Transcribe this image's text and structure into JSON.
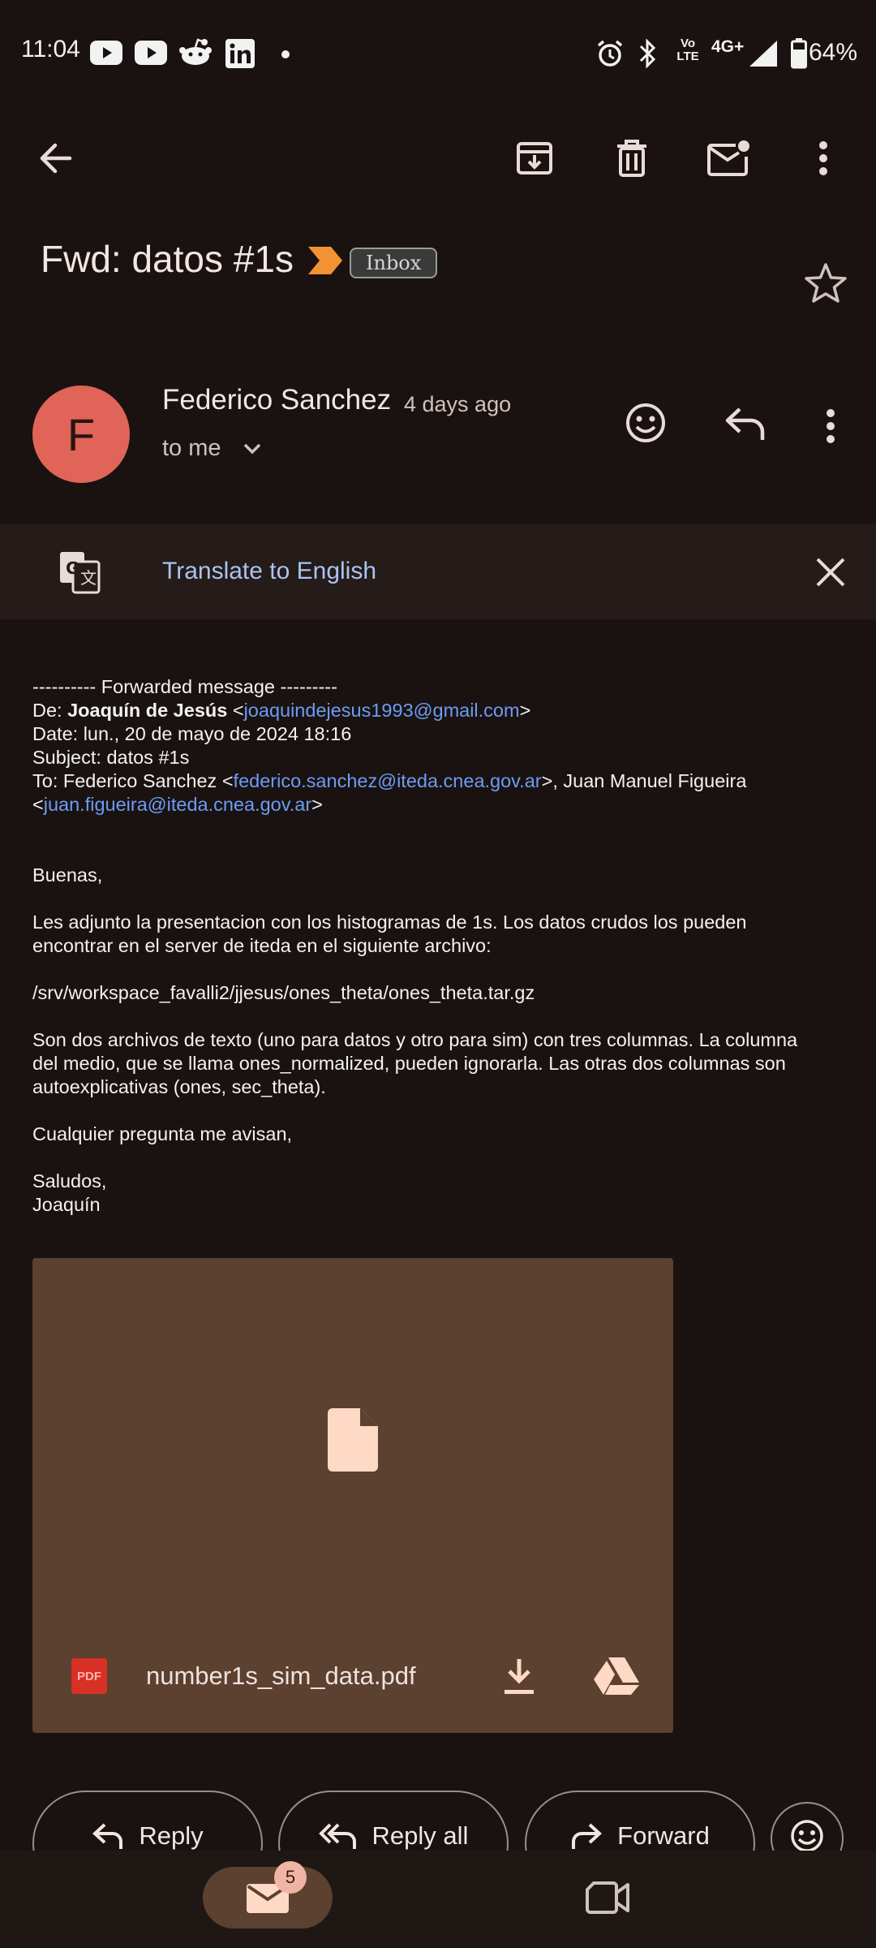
{
  "status_bar": {
    "time": "11:04",
    "battery": "64%",
    "network": "4G+",
    "network_sub": "Vo LTE",
    "icons": [
      "youtube-icon",
      "youtube-icon",
      "reddit-icon",
      "linkedin-icon",
      "dot-icon",
      "alarm-icon",
      "bluetooth-icon",
      "volte-icon",
      "signal-icon",
      "battery-icon"
    ]
  },
  "toolbar": {
    "icons": [
      "back-arrow-icon",
      "archive-icon",
      "delete-icon",
      "mark-unread-icon",
      "more-vert-icon"
    ]
  },
  "email": {
    "subject": "Fwd: datos #1s",
    "label": "Inbox",
    "sender_initial": "F",
    "sender_name": "Federico Sanchez",
    "time": "4 days ago",
    "recipient": "to me"
  },
  "translate": {
    "label": "Translate to English"
  },
  "body": {
    "fwd_header": "---------- Forwarded message ---------",
    "from_prefix": "De: ",
    "from_name": "Joaquín de Jesús",
    "from_open": " <",
    "from_email": "joaquindejesus1993@gmail.com",
    "from_close": ">",
    "date": "Date: lun., 20 de mayo de 2024 18:16",
    "subject": "Subject: datos #1s",
    "to_prefix": "To: Federico Sanchez <",
    "to_email1": "federico.sanchez@iteda.cnea.gov.ar",
    "to_mid": ">, Juan Manuel Figueira",
    "to_open2": "<",
    "to_email2": "juan.figueira@iteda.cnea.gov.ar",
    "to_close2": ">",
    "greeting": "Buenas,",
    "p1_l1": "Les adjunto la presentacion con los histogramas de 1s. Los datos crudos los pueden",
    "p1_l2": "encontrar en el server de iteda en el siguiente archivo:",
    "path": "/srv/workspace_favalli2/jjesus/ones_theta/ones_theta.tar.gz",
    "p2_l1": "Son dos archivos de texto (uno para datos y otro para sim) con tres columnas. La columna",
    "p2_l2": "del medio, que se llama ones_normalized, pueden ignorarla. Las otras dos columnas son",
    "p2_l3": "autoexplicativas (ones, sec_theta).",
    "p3": "Cualquier pregunta me avisan,",
    "sign1": "Saludos,",
    "sign2": "Joaquín"
  },
  "attachment": {
    "file_name": "number1s_sim_data.pdf",
    "badge": "PDF"
  },
  "actions": {
    "reply": "Reply",
    "reply_all": "Reply all",
    "forward": "Forward"
  },
  "bottom_nav": {
    "mail_badge": "5"
  },
  "colors": {
    "background": "#1a1210",
    "avatar": "#e06458",
    "link": "#6b9cf6",
    "translate_link": "#a9c4f2",
    "attachment_card": "#5c4030",
    "label_arrow": "#f29233"
  }
}
